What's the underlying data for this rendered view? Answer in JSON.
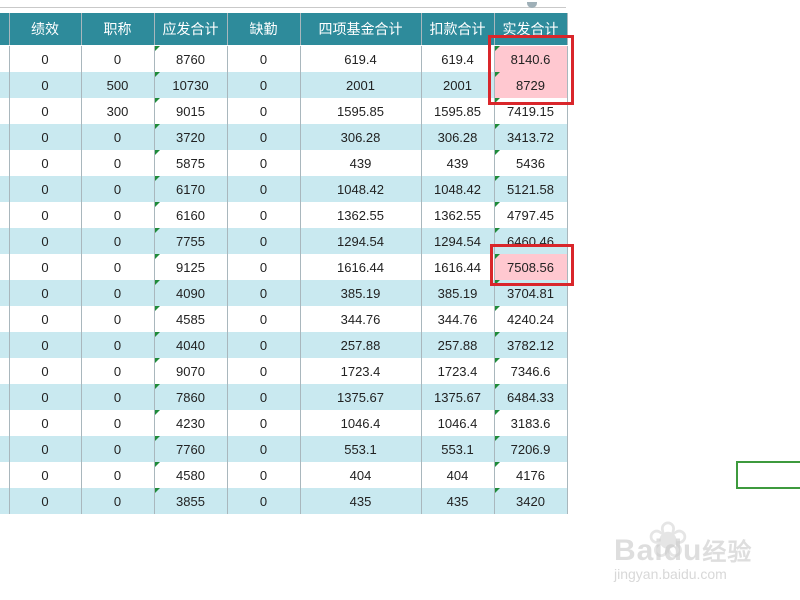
{
  "spreadsheet": {
    "columns": [
      "绩效",
      "职称",
      "应发合计",
      "缺勤",
      "四项基金合计",
      "扣款合计",
      "实发合计"
    ],
    "rows": [
      [
        "0",
        "0",
        "8760",
        "0",
        "619.4",
        "619.4",
        "8140.6"
      ],
      [
        "0",
        "500",
        "10730",
        "0",
        "2001",
        "2001",
        "8729"
      ],
      [
        "0",
        "300",
        "9015",
        "0",
        "1595.85",
        "1595.85",
        "7419.15"
      ],
      [
        "0",
        "0",
        "3720",
        "0",
        "306.28",
        "306.28",
        "3413.72"
      ],
      [
        "0",
        "0",
        "5875",
        "0",
        "439",
        "439",
        "5436"
      ],
      [
        "0",
        "0",
        "6170",
        "0",
        "1048.42",
        "1048.42",
        "5121.58"
      ],
      [
        "0",
        "0",
        "6160",
        "0",
        "1362.55",
        "1362.55",
        "4797.45"
      ],
      [
        "0",
        "0",
        "7755",
        "0",
        "1294.54",
        "1294.54",
        "6460.46"
      ],
      [
        "0",
        "0",
        "9125",
        "0",
        "1616.44",
        "1616.44",
        "7508.56"
      ],
      [
        "0",
        "0",
        "4090",
        "0",
        "385.19",
        "385.19",
        "3704.81"
      ],
      [
        "0",
        "0",
        "4585",
        "0",
        "344.76",
        "344.76",
        "4240.24"
      ],
      [
        "0",
        "0",
        "4040",
        "0",
        "257.88",
        "257.88",
        "3782.12"
      ],
      [
        "0",
        "0",
        "9070",
        "0",
        "1723.4",
        "1723.4",
        "7346.6"
      ],
      [
        "0",
        "0",
        "7860",
        "0",
        "1375.67",
        "1375.67",
        "6484.33"
      ],
      [
        "0",
        "0",
        "4230",
        "0",
        "1046.4",
        "1046.4",
        "3183.6"
      ],
      [
        "0",
        "0",
        "7760",
        "0",
        "553.1",
        "553.1",
        "7206.9"
      ],
      [
        "0",
        "0",
        "4580",
        "0",
        "404",
        "404",
        "4176"
      ],
      [
        "0",
        "0",
        "3855",
        "0",
        "435",
        "435",
        "3420"
      ]
    ],
    "highlighted_cells": [
      [
        0,
        6
      ],
      [
        1,
        6
      ],
      [
        8,
        6
      ]
    ],
    "colors": {
      "header_bg": "#2e8b9b",
      "band_row": "#c9e9f0",
      "highlight_fill": "#ffc8d0",
      "highlight_text": "#c0202a",
      "annotation_box": "#d9262b",
      "selection": "#3d9a3d"
    }
  },
  "watermark": {
    "brand_latin": "Bai",
    "brand_du": "du",
    "brand_cn": "经验",
    "url": "jingyan.baidu.com",
    "icon": "paw-icon"
  }
}
